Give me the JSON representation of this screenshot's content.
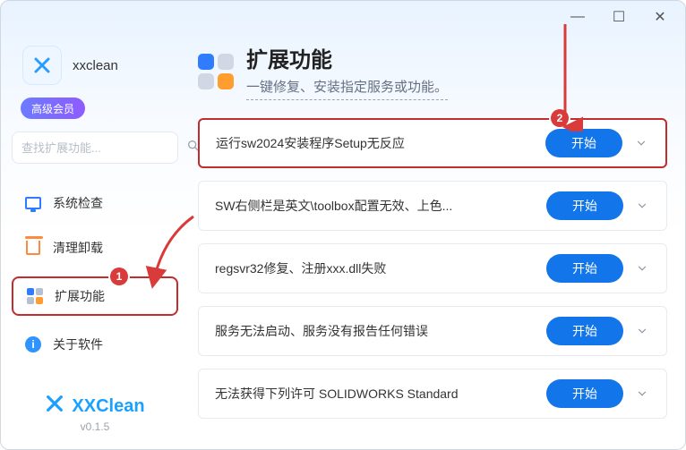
{
  "titlebar": {
    "min": "—",
    "max": "☐",
    "close": "✕"
  },
  "brand": {
    "name": "xxclean",
    "badge": "高级会员"
  },
  "search": {
    "placeholder": "查找扩展功能..."
  },
  "nav": [
    {
      "key": "syscheck",
      "label": "系统检查"
    },
    {
      "key": "cleanup",
      "label": "清理卸载"
    },
    {
      "key": "ext",
      "label": "扩展功能"
    },
    {
      "key": "about",
      "label": "关于软件"
    }
  ],
  "footer": {
    "name": "XXClean",
    "version": "v0.1.5"
  },
  "header": {
    "title": "扩展功能",
    "subtitle": "一键修复、安装指定服务或功能。"
  },
  "items": [
    {
      "title": "运行sw2024安装程序Setup无反应",
      "action": "开始"
    },
    {
      "title": "SW右侧栏是英文\\toolbox配置无效、上色...",
      "action": "开始"
    },
    {
      "title": "regsvr32修复、注册xxx.dll失败",
      "action": "开始"
    },
    {
      "title": "服务无法启动、服务没有报告任何错误",
      "action": "开始"
    },
    {
      "title": "无法获得下列许可 SOLIDWORKS Standard",
      "action": "开始"
    }
  ],
  "callouts": {
    "nav": "1",
    "item0": "2"
  }
}
